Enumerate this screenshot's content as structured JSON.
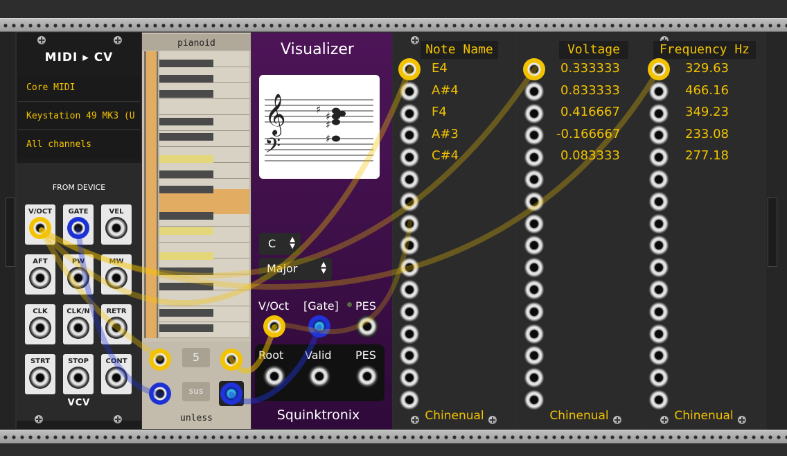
{
  "midi_cv": {
    "title": "MIDI ▸ CV",
    "driver": "Core MIDI",
    "device": "Keystation 49 MK3 (U",
    "channel": "All channels",
    "section": "FROM DEVICE",
    "jacks": [
      "V/OCT",
      "GATE",
      "VEL",
      "AFT",
      "PW",
      "MW",
      "CLK",
      "CLK/N",
      "RETR",
      "STRT",
      "STOP",
      "CONT"
    ],
    "brand": "VCV"
  },
  "pianoid": {
    "title": "pianoid",
    "footer": "unless",
    "button_value": "5",
    "button_sus": "sus"
  },
  "visualizer": {
    "title": "Visualizer",
    "key": "C",
    "mode": "Major",
    "in_labels": [
      "V/Oct",
      "[Gate]",
      "PES"
    ],
    "out_labels": [
      "Root",
      "Valid",
      "PES"
    ],
    "brand": "Squinktronix"
  },
  "note_name": {
    "title": "Note Name",
    "values": [
      "E4",
      "A#4",
      "F4",
      "A#3",
      "C#4"
    ],
    "brand": "Chinenual"
  },
  "voltage": {
    "title": "Voltage",
    "values": [
      "0.333333",
      "0.833333",
      "0.416667",
      "-0.166667",
      "0.083333"
    ],
    "brand": "Chinenual"
  },
  "frequency": {
    "title": "Frequency Hz",
    "values": [
      "329.63",
      "466.16",
      "349.23",
      "233.08",
      "277.18"
    ],
    "brand": "Chinenual"
  },
  "colors": {
    "cable_yellow": "#f4c300",
    "cable_blue": "#1f33d8",
    "visualizer_bg": "#4a0f55",
    "display_text": "#f2c200"
  }
}
